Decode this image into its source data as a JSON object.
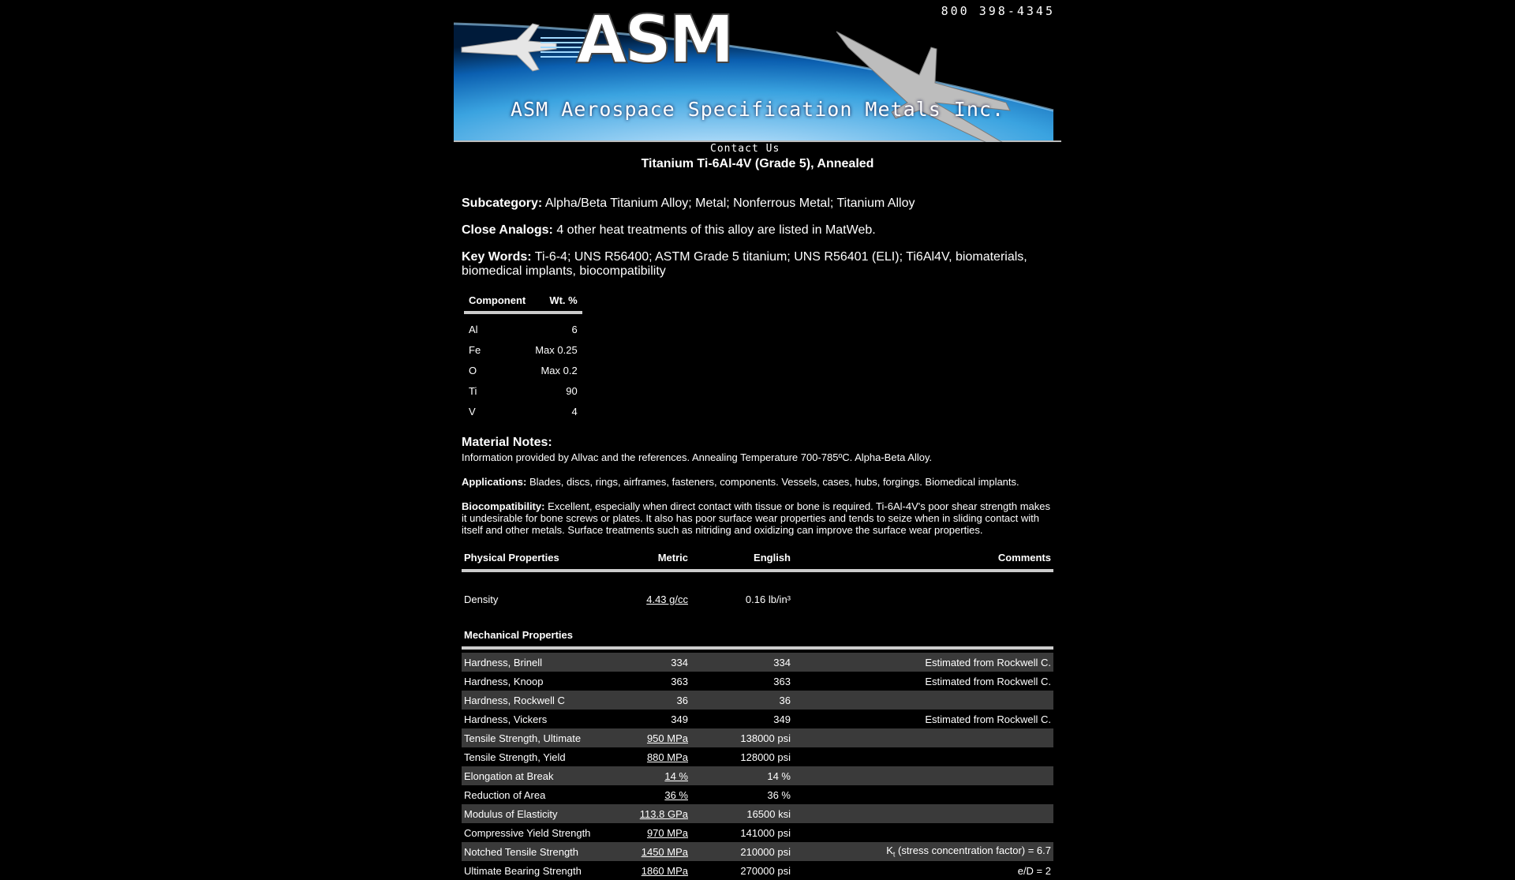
{
  "header": {
    "phone": "800 398-4345",
    "logo_text": "ASM",
    "company": "ASM Aerospace Specification Metals Inc.",
    "contact_link": "Contact Us"
  },
  "page_title": "Titanium Ti-6Al-4V (Grade 5), Annealed",
  "subcategory": {
    "label": "Subcategory:",
    "value": "Alpha/Beta Titanium Alloy; Metal; Nonferrous Metal; Titanium Alloy"
  },
  "close_analogs": {
    "label": "Close Analogs:",
    "value": "4 other heat treatments of this alloy are listed in MatWeb."
  },
  "key_words": {
    "label": "Key Words:",
    "value": "Ti-6-4; UNS R56400; ASTM Grade 5 titanium; UNS R56401 (ELI); Ti6Al4V, biomaterials, biomedical implants, biocompatibility"
  },
  "composition": {
    "headers": [
      "Component",
      "Wt. %"
    ],
    "rows": [
      [
        "Al",
        "6"
      ],
      [
        "Fe",
        "Max 0.25"
      ],
      [
        "O",
        "Max 0.2"
      ],
      [
        "Ti",
        "90"
      ],
      [
        "V",
        "4"
      ]
    ]
  },
  "material_notes": {
    "heading": "Material Notes:",
    "text": "Information provided by Allvac and the references. Annealing Temperature 700-785ºC. Alpha-Beta Alloy.",
    "applications_label": "Applications:",
    "applications": "Blades, discs, rings, airframes, fasteners, components. Vessels, cases, hubs, forgings. Biomedical implants.",
    "biocompat_label": "Biocompatibility:",
    "biocompat": "Excellent, especially when direct contact with tissue or bone is required. Ti-6Al-4V's poor shear strength makes it undesirable for bone screws or plates. It also has poor surface wear properties and tends to seize when in sliding contact with itself and other metals. Surface treatments such as nitriding and oxidizing can improve the surface wear properties."
  },
  "properties": {
    "physical_heading": "Physical Properties",
    "metric_heading": "Metric",
    "english_heading": "English",
    "comments_heading": "Comments",
    "physical_rows": [
      {
        "name": "Density",
        "metric": "4.43 g/cc",
        "english": "0.16 lb/in³",
        "comment": ""
      }
    ],
    "mechanical_heading": "Mechanical Properties",
    "mechanical_rows": [
      {
        "name": "Hardness, Brinell",
        "metric": "334",
        "english": "334",
        "comment": "Estimated from Rockwell C."
      },
      {
        "name": "Hardness, Knoop",
        "metric": "363",
        "english": "363",
        "comment": "Estimated from Rockwell C."
      },
      {
        "name": "Hardness, Rockwell C",
        "metric": "36",
        "english": "36",
        "comment": ""
      },
      {
        "name": "Hardness, Vickers",
        "metric": "349",
        "english": "349",
        "comment": "Estimated from Rockwell C."
      },
      {
        "name": "Tensile Strength, Ultimate",
        "metric": "950 MPa",
        "english": "138000 psi",
        "comment": ""
      },
      {
        "name": "Tensile Strength, Yield",
        "metric": "880 MPa",
        "english": "128000 psi",
        "comment": ""
      },
      {
        "name": "Elongation at Break",
        "metric": "14 %",
        "english": "14 %",
        "comment": ""
      },
      {
        "name": "Reduction of Area",
        "metric": "36 %",
        "english": "36 %",
        "comment": ""
      },
      {
        "name": "Modulus of Elasticity",
        "metric": "113.8 GPa",
        "english": "16500 ksi",
        "comment": ""
      },
      {
        "name": "Compressive Yield Strength",
        "metric": "970 MPa",
        "english": "141000 psi",
        "comment": ""
      },
      {
        "name": "Notched Tensile Strength",
        "metric": "1450 MPa",
        "english": "210000 psi",
        "comment_k": "K",
        "comment_sub": "t",
        "comment": " (stress concentration factor) = 6.7"
      },
      {
        "name": "Ultimate Bearing Strength",
        "metric": "1860 MPa",
        "english": "270000 psi",
        "comment": "e/D = 2"
      }
    ]
  }
}
